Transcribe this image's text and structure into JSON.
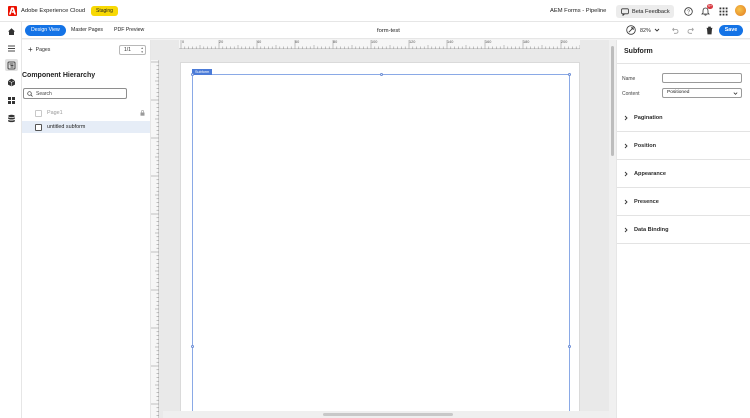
{
  "header": {
    "app_title": "Adobe Experience Cloud",
    "env_badge": "Staging",
    "program": "AEM Forms - Pipeline",
    "beta_feedback": "Beta Feedback",
    "notification_count": "9+"
  },
  "toolbar": {
    "tabs": [
      {
        "label": "Design View",
        "active": true
      },
      {
        "label": "Master Pages",
        "active": false
      },
      {
        "label": "PDF Preview",
        "active": false
      }
    ],
    "document_title": "form-test",
    "zoom": "82%",
    "save_label": "Save"
  },
  "left_panel": {
    "pages_label": "Pages",
    "page_value": "1/1",
    "hierarchy_title": "Component Hierarchy",
    "search_placeholder": "Search",
    "tree": [
      {
        "label": "Page1",
        "dim": true,
        "locked": true
      },
      {
        "label": "untitled subform",
        "selected": true
      }
    ]
  },
  "canvas": {
    "ruler_h": [
      "0",
      "20",
      "40",
      "60",
      "80",
      "100",
      "120",
      "140",
      "160",
      "180",
      "200"
    ],
    "subform_tag": "Subform"
  },
  "right_panel": {
    "title": "Subform",
    "name_label": "Name",
    "name_value": "",
    "content_label": "Content",
    "content_value": "Positioned",
    "sections": [
      "Pagination",
      "Position",
      "Appearance",
      "Presence",
      "Data Binding"
    ]
  },
  "colors": {
    "accent": "#1473e6",
    "brand": "#eb1000",
    "badge": "#f8d904"
  }
}
